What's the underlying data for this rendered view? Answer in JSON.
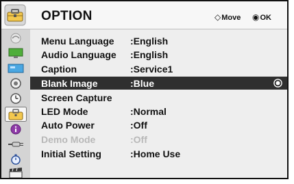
{
  "header": {
    "title": "OPTION",
    "hints": [
      {
        "icon": "dpad-icon",
        "glyph": "◇",
        "label": "Move"
      },
      {
        "icon": "ok-button-icon",
        "glyph": "◉",
        "label": "OK"
      }
    ]
  },
  "sidebar": {
    "icons": [
      "picture-icon",
      "monitor-icon",
      "screen-icon",
      "speaker-icon",
      "clock-icon",
      "option-toolbox-icon",
      "info-icon",
      "input-plug-icon",
      "stopwatch-icon",
      "film-clapper-icon"
    ],
    "selected": "option-toolbox-icon"
  },
  "menu": {
    "items": [
      {
        "label": "Menu Language",
        "value": ":English"
      },
      {
        "label": "Audio Language",
        "value": ":English"
      },
      {
        "label": "Caption",
        "value": ":Service1"
      },
      {
        "label": "Blank Image",
        "value": ":Blue",
        "state": "highlighted"
      },
      {
        "label": "Screen Capture",
        "value": ""
      },
      {
        "label": "LED Mode",
        "value": ":Normal"
      },
      {
        "label": "Auto Power",
        "value": ":Off"
      },
      {
        "label": "Demo Mode",
        "value": ":Off",
        "state": "disabled"
      },
      {
        "label": "Initial Setting",
        "value": ":Home Use"
      }
    ]
  },
  "colors": {
    "highlight_bg": "#2f2f2f",
    "sidebar_bg": "#d4d4d4",
    "panel_bg": "#eeeeee",
    "disabled_text": "#b8b8b8"
  }
}
